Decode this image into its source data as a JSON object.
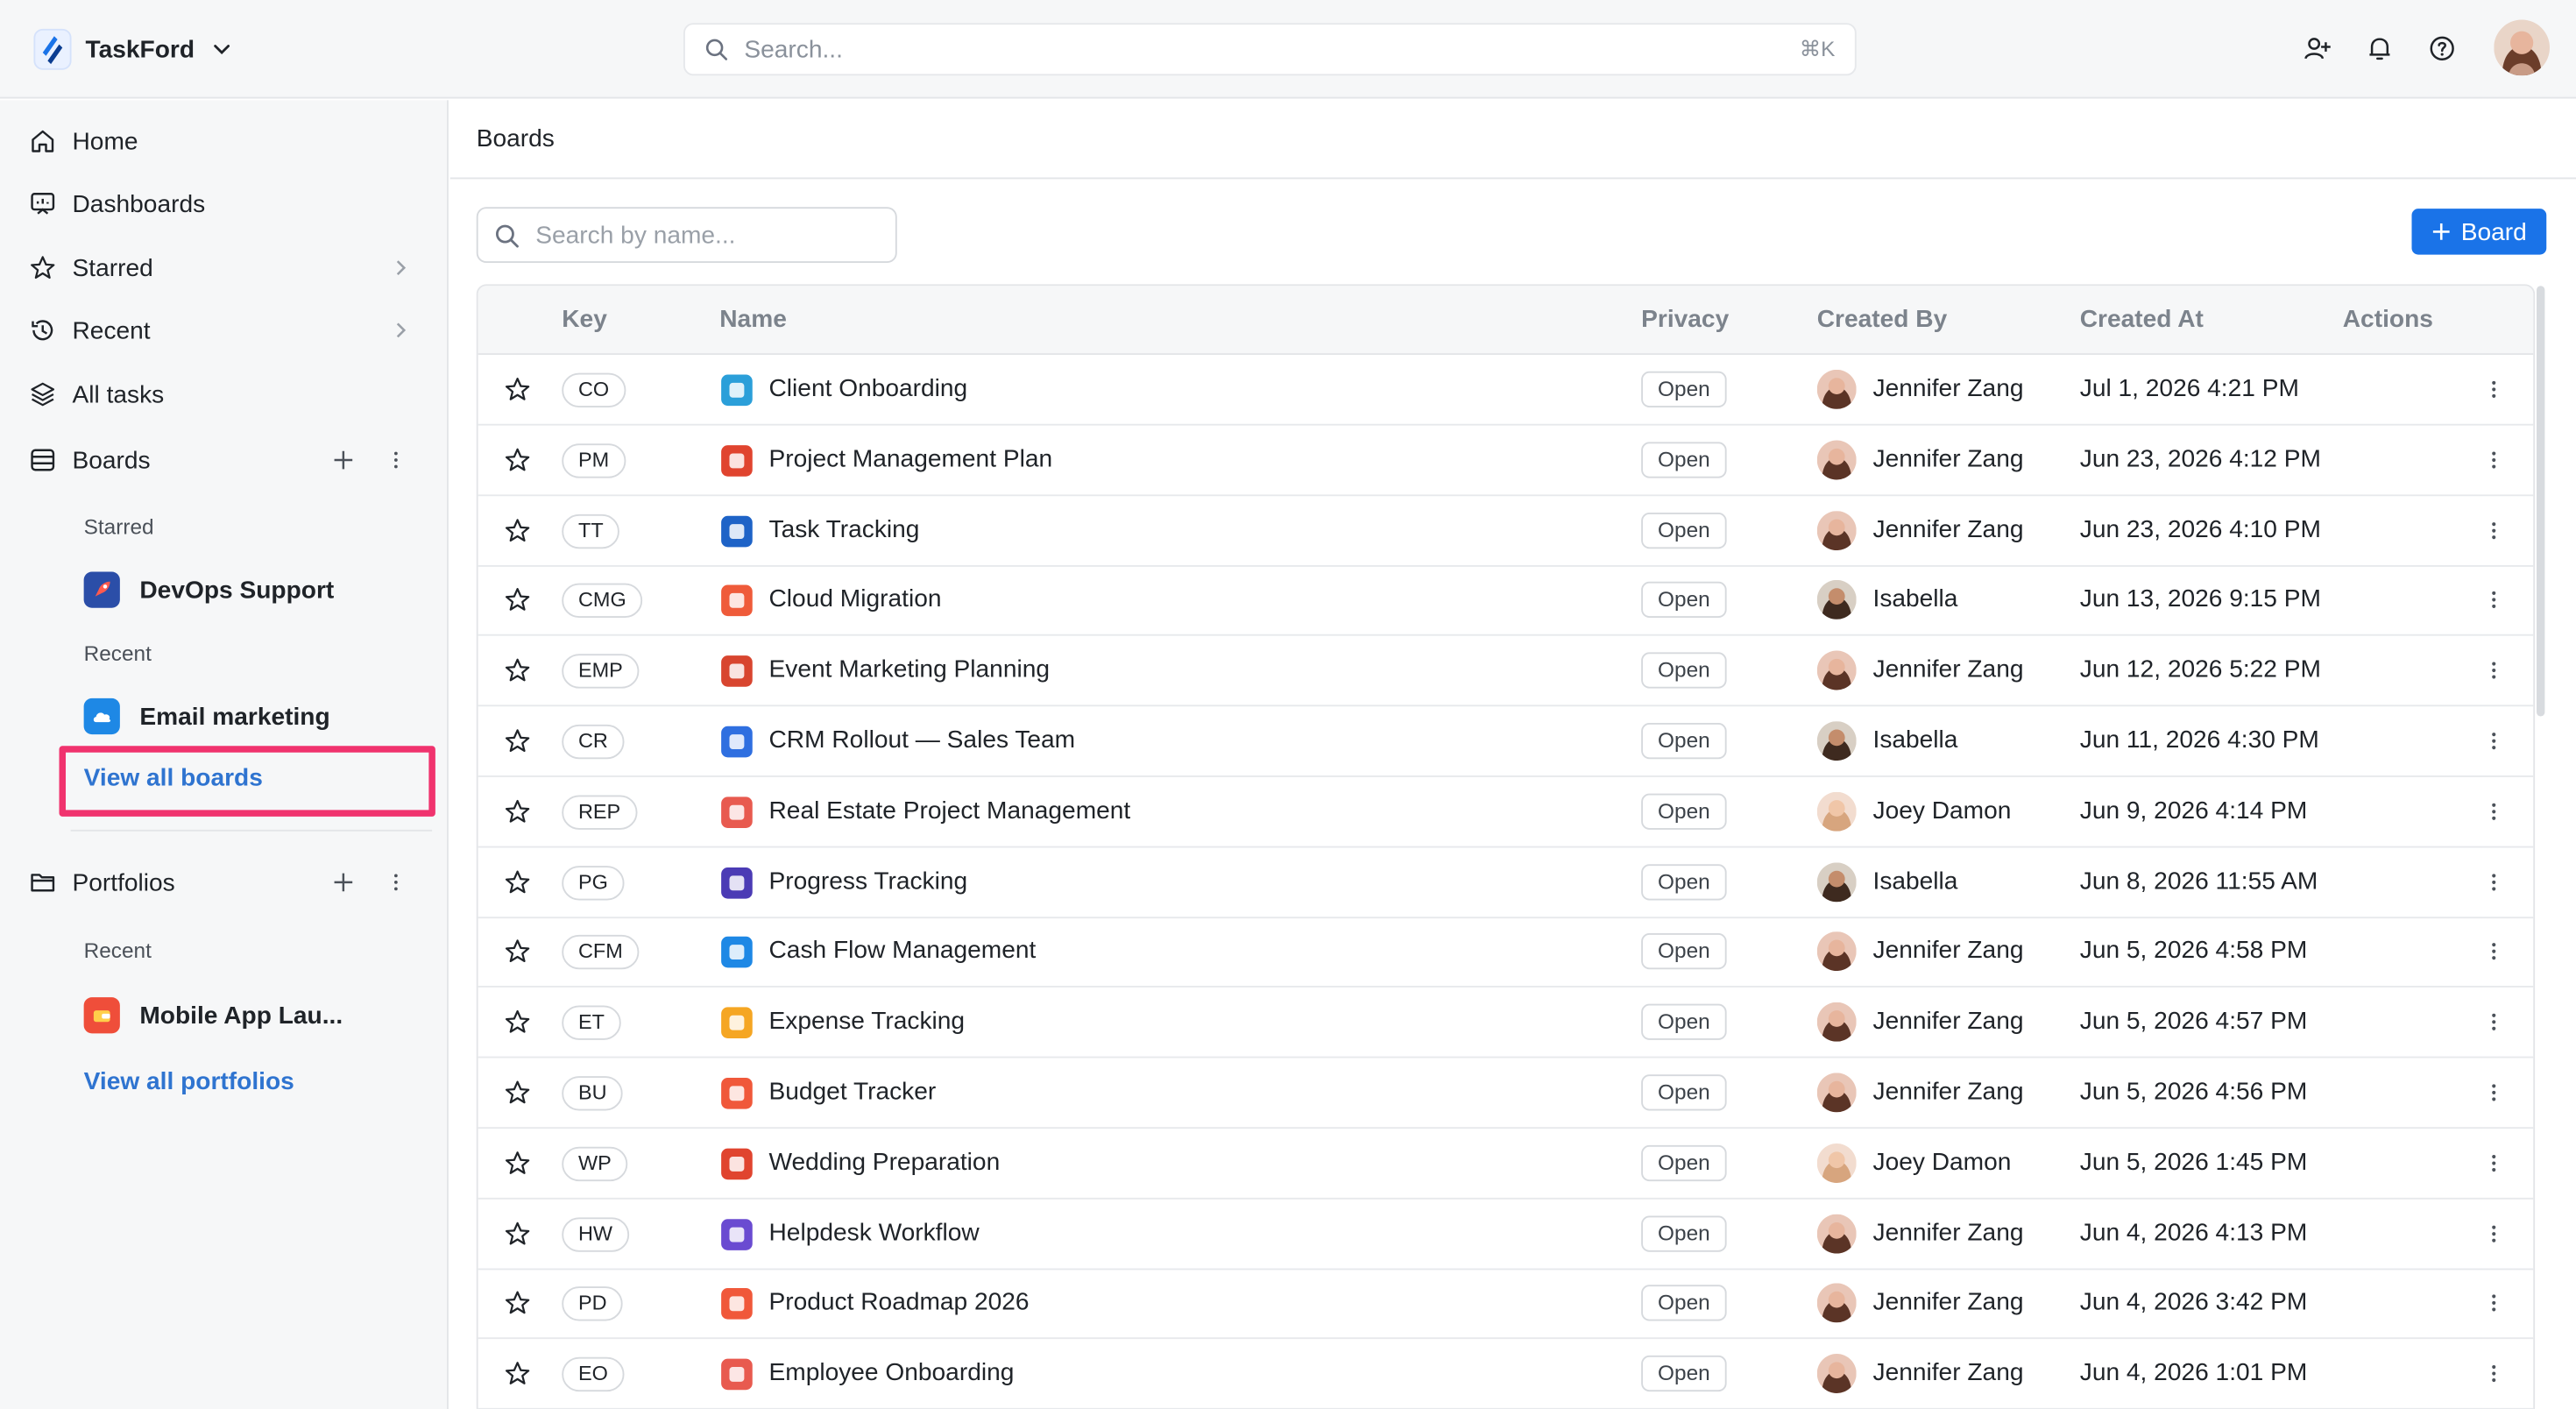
{
  "app": {
    "name": "TaskFord",
    "search_placeholder": "Search...",
    "search_shortcut": "⌘K"
  },
  "sidebar": {
    "home": "Home",
    "dashboards": "Dashboards",
    "starred": "Starred",
    "recent": "Recent",
    "all_tasks": "All tasks",
    "boards": "Boards",
    "boards_starred_label": "Starred",
    "boards_starred_item": "DevOps Support",
    "boards_recent_label": "Recent",
    "boards_recent_item": "Email marketing",
    "view_all_boards": "View all boards",
    "portfolios": "Portfolios",
    "portfolios_recent_label": "Recent",
    "portfolios_recent_item": "Mobile App Lau...",
    "view_all_portfolios": "View all portfolios"
  },
  "main": {
    "title": "Boards",
    "search_placeholder": "Search by name...",
    "add_board_label": "Board",
    "columns": {
      "key": "Key",
      "name": "Name",
      "privacy": "Privacy",
      "created_by": "Created By",
      "created_at": "Created At",
      "actions": "Actions"
    },
    "rows": [
      {
        "key": "CO",
        "name": "Client Onboarding",
        "privacy": "Open",
        "created_by": "Jennifer Zang",
        "created_at": "Jul 1, 2026 4:21 PM"
      },
      {
        "key": "PM",
        "name": "Project Management Plan",
        "privacy": "Open",
        "created_by": "Jennifer Zang",
        "created_at": "Jun 23, 2026 4:12 PM"
      },
      {
        "key": "TT",
        "name": "Task Tracking",
        "privacy": "Open",
        "created_by": "Jennifer Zang",
        "created_at": "Jun 23, 2026 4:10 PM"
      },
      {
        "key": "CMG",
        "name": "Cloud Migration",
        "privacy": "Open",
        "created_by": "Isabella",
        "created_at": "Jun 13, 2026 9:15 PM"
      },
      {
        "key": "EMP",
        "name": "Event Marketing Planning",
        "privacy": "Open",
        "created_by": "Jennifer Zang",
        "created_at": "Jun 12, 2026 5:22 PM"
      },
      {
        "key": "CR",
        "name": "CRM Rollout — Sales Team",
        "privacy": "Open",
        "created_by": "Isabella",
        "created_at": "Jun 11, 2026 4:30 PM"
      },
      {
        "key": "REP",
        "name": "Real Estate Project Management",
        "privacy": "Open",
        "created_by": "Joey Damon",
        "created_at": "Jun 9, 2026 4:14 PM"
      },
      {
        "key": "PG",
        "name": "Progress Tracking",
        "privacy": "Open",
        "created_by": "Isabella",
        "created_at": "Jun 8, 2026 11:55 AM"
      },
      {
        "key": "CFM",
        "name": "Cash Flow Management",
        "privacy": "Open",
        "created_by": "Jennifer Zang",
        "created_at": "Jun 5, 2026 4:58 PM"
      },
      {
        "key": "ET",
        "name": "Expense Tracking",
        "privacy": "Open",
        "created_by": "Jennifer Zang",
        "created_at": "Jun 5, 2026 4:57 PM"
      },
      {
        "key": "BU",
        "name": "Budget Tracker",
        "privacy": "Open",
        "created_by": "Jennifer Zang",
        "created_at": "Jun 5, 2026 4:56 PM"
      },
      {
        "key": "WP",
        "name": "Wedding Preparation",
        "privacy": "Open",
        "created_by": "Joey Damon",
        "created_at": "Jun 5, 2026 1:45 PM"
      },
      {
        "key": "HW",
        "name": "Helpdesk Workflow",
        "privacy": "Open",
        "created_by": "Jennifer Zang",
        "created_at": "Jun 4, 2026 4:13 PM"
      },
      {
        "key": "PD",
        "name": "Product Roadmap 2026",
        "privacy": "Open",
        "created_by": "Jennifer Zang",
        "created_at": "Jun 4, 2026 3:42 PM"
      },
      {
        "key": "EO",
        "name": "Employee Onboarding",
        "privacy": "Open",
        "created_by": "Jennifer Zang",
        "created_at": "Jun 4, 2026 1:01 PM"
      }
    ]
  },
  "colors": {
    "accent": "#1a73e8",
    "link": "#2f74d0",
    "highlight": "#f0336e"
  }
}
